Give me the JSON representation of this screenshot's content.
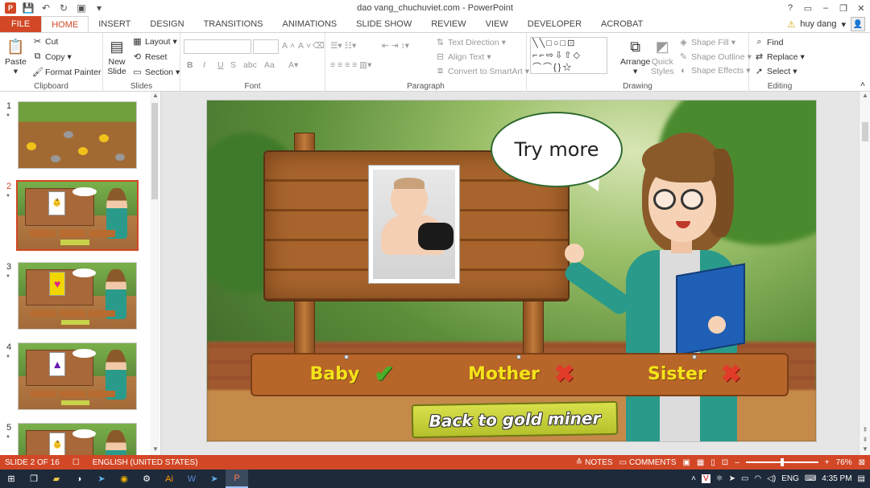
{
  "window": {
    "title": "dao vang_chuchuviet.com - PowerPoint"
  },
  "quick_access": {
    "icons": [
      "powerpoint-logo-icon",
      "save-icon",
      "undo-icon",
      "redo-icon",
      "start-from-beginning-icon",
      "customize-icon"
    ]
  },
  "tabs": [
    "FILE",
    "HOME",
    "INSERT",
    "DESIGN",
    "TRANSITIONS",
    "ANIMATIONS",
    "SLIDE SHOW",
    "REVIEW",
    "VIEW",
    "DEVELOPER",
    "ACROBAT"
  ],
  "active_tab": "HOME",
  "user": {
    "name": "huy dang"
  },
  "ribbon": {
    "clipboard": {
      "label": "Clipboard",
      "paste": "Paste",
      "cut": "Cut",
      "copy": "Copy",
      "format_painter": "Format Painter"
    },
    "slides": {
      "label": "Slides",
      "new_slide": "New",
      "new_slide_2": "Slide",
      "layout": "Layout",
      "reset": "Reset",
      "section": "Section"
    },
    "font": {
      "label": "Font",
      "bold": "B",
      "italic": "I",
      "underline": "U",
      "strike": "S",
      "spacing": "abc",
      "case": "Aa",
      "grow": "A",
      "shrink": "A"
    },
    "paragraph": {
      "label": "Paragraph",
      "text_direction": "Text Direction",
      "align_text": "Align Text",
      "convert_smartart": "Convert to SmartArt"
    },
    "drawing": {
      "label": "Drawing",
      "arrange": "Arrange",
      "quick_styles": "Quick",
      "quick_styles_2": "Styles",
      "shape_fill": "Shape Fill",
      "shape_outline": "Shape Outline",
      "shape_effects": "Shape Effects"
    },
    "editing": {
      "label": "Editing",
      "find": "Find",
      "replace": "Replace",
      "select": "Select"
    }
  },
  "thumbnails": [
    {
      "number": "1",
      "marker": "*"
    },
    {
      "number": "2",
      "marker": "*"
    },
    {
      "number": "3",
      "marker": "*"
    },
    {
      "number": "4",
      "marker": "*"
    },
    {
      "number": "5",
      "marker": "*"
    }
  ],
  "slide": {
    "bubble_text": "Try more",
    "options": [
      {
        "label": "Baby",
        "mark": "✔"
      },
      {
        "label": "Mother",
        "mark": "✖"
      },
      {
        "label": "Sister",
        "mark": "✖"
      }
    ],
    "back_button": "Back to gold miner"
  },
  "status": {
    "slide_info": "SLIDE 2 OF 16",
    "language": "ENGLISH (UNITED STATES)",
    "notes": "NOTES",
    "comments": "COMMENTS",
    "zoom": "76%",
    "zoom_level": 0.5
  },
  "taskbar": {
    "language": "ENG",
    "time": "4:35 PM"
  },
  "colors": {
    "accent": "#d24726",
    "correct": "#4caf2a",
    "wrong": "#e23b2a",
    "label_yellow": "#f4e31a"
  }
}
